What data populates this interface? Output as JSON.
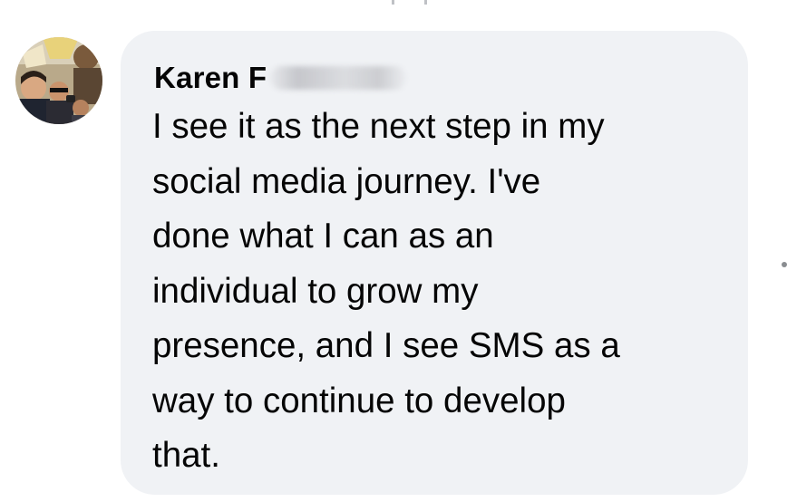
{
  "comment": {
    "author_name": "Karen F",
    "text": "I see it as the next step in my\nsocial media journey. I've\ndone what I can as an\nindividual to grow my\npresence, and I see SMS as a\nway to continue to develop\nthat."
  },
  "avatar": {
    "description_icon": "group-photo-avatar"
  },
  "colors": {
    "bubble_background": "#f0f2f5",
    "text": "#050505"
  }
}
